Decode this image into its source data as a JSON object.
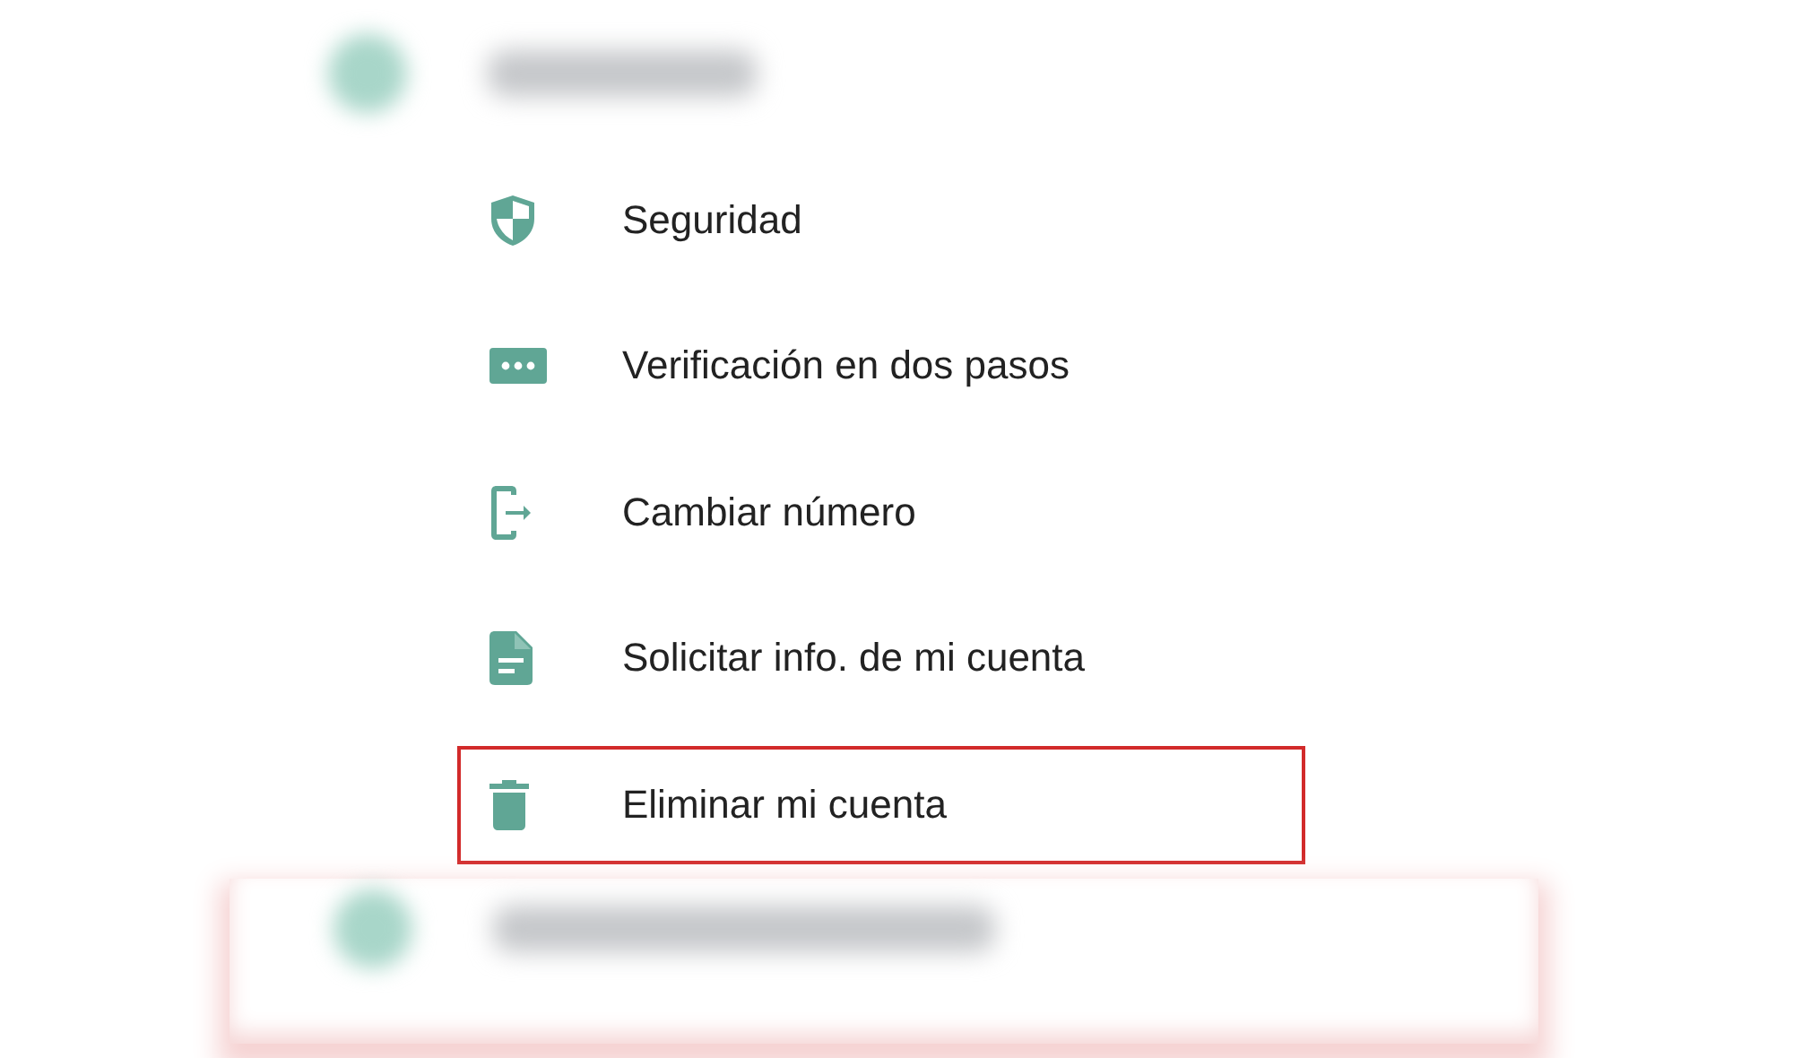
{
  "items": [
    {
      "kind": "shield",
      "label": "Seguridad",
      "highlighted": false
    },
    {
      "kind": "dots",
      "label": "Verificación en dos pasos",
      "highlighted": false
    },
    {
      "kind": "phone-exit",
      "label": "Cambiar número",
      "highlighted": false
    },
    {
      "kind": "document",
      "label": "Solicitar info. de mi cuenta",
      "highlighted": false
    },
    {
      "kind": "trash",
      "label": "Eliminar mi cuenta",
      "highlighted": true
    }
  ]
}
